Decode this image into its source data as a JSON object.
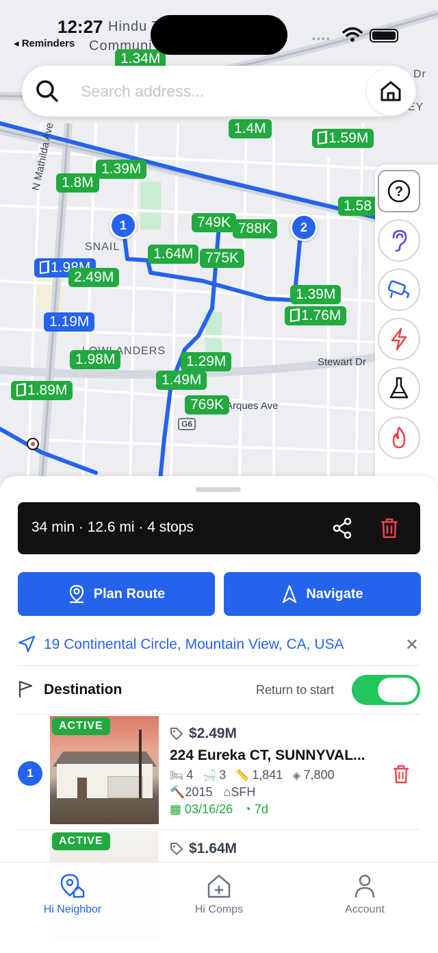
{
  "status_bar": {
    "time": "12:27",
    "back_app": "◂ Reminders"
  },
  "map": {
    "labels": {
      "hindu": "Hindu T",
      "community": "Communi",
      "snail": "SNAIL",
      "lowlanders": "LOWLANDERS",
      "stewart": "Stewart Dr",
      "arques": "Arques Ave",
      "mathilda": "N Mathilda Ave",
      "hwy": "G6",
      "ke": "KE",
      "dr": "Dr",
      "ey": "EY"
    },
    "price_pins": [
      {
        "label": "1.34M",
        "color": "green"
      },
      {
        "label": "1.4M",
        "color": "green"
      },
      {
        "label": "1.59M",
        "color": "green",
        "door": true
      },
      {
        "label": "1.39M",
        "color": "green"
      },
      {
        "label": "1.8M",
        "color": "green"
      },
      {
        "label": "1.58",
        "color": "green"
      },
      {
        "label": "749K",
        "color": "green"
      },
      {
        "label": "788K",
        "color": "green"
      },
      {
        "label": "1.64M",
        "color": "green"
      },
      {
        "label": "775K",
        "color": "green"
      },
      {
        "label": "1.98M",
        "color": "blue",
        "door": true
      },
      {
        "label": "2.49M",
        "color": "green"
      },
      {
        "label": "1.39M",
        "color": "green"
      },
      {
        "label": "1.76M",
        "color": "green",
        "door": true
      },
      {
        "label": "1.19M",
        "color": "blue"
      },
      {
        "label": "1.98M",
        "color": "green"
      },
      {
        "label": "1.29M",
        "color": "green"
      },
      {
        "label": "1.49M",
        "color": "green"
      },
      {
        "label": "1.89M",
        "color": "green",
        "door": true
      },
      {
        "label": "769K",
        "color": "green"
      }
    ],
    "stops": [
      "1",
      "2"
    ]
  },
  "search": {
    "placeholder": "Search address..."
  },
  "tools": [
    {
      "icon": "question-icon",
      "color": "#111111"
    },
    {
      "icon": "ear-icon",
      "color": "#4f46e5"
    },
    {
      "icon": "camera-icon",
      "color": "#2563eb"
    },
    {
      "icon": "lightning-icon",
      "color": "#ef4444"
    },
    {
      "icon": "flask-icon",
      "color": "#111111"
    },
    {
      "icon": "fire-icon",
      "color": "#ef4444"
    }
  ],
  "summary": {
    "text": "34 min · 12.6 mi · 4 stops"
  },
  "buttons": {
    "plan_route": "Plan Route",
    "navigate": "Navigate"
  },
  "start": {
    "address": "19 Continental Circle, Mountain View, CA, USA"
  },
  "destination": {
    "label": "Destination",
    "return_label": "Return to start",
    "return_enabled": true
  },
  "listings": [
    {
      "index": "1",
      "status": "ACTIVE",
      "price": "$2.49M",
      "address": "224 Eureka CT, SUNNYVAL...",
      "beds": "4",
      "baths": "3",
      "sqft": "1,841",
      "lot": "7,800",
      "year": "2015",
      "type": "SFH",
      "date": "03/16/26",
      "dom": "7d"
    },
    {
      "status": "ACTIVE",
      "price": "$1.64M"
    }
  ],
  "colors": {
    "accent": "#2563eb",
    "pin_green": "#22a93f",
    "danger": "#ef4444",
    "toggle_on": "#22c55e"
  },
  "tabs": [
    {
      "label": "Hi Neighbor",
      "icon": "home-pin-icon",
      "active": true
    },
    {
      "label": "Hi Comps",
      "icon": "house-plus-icon",
      "active": false
    },
    {
      "label": "Account",
      "icon": "person-icon",
      "active": false
    }
  ]
}
